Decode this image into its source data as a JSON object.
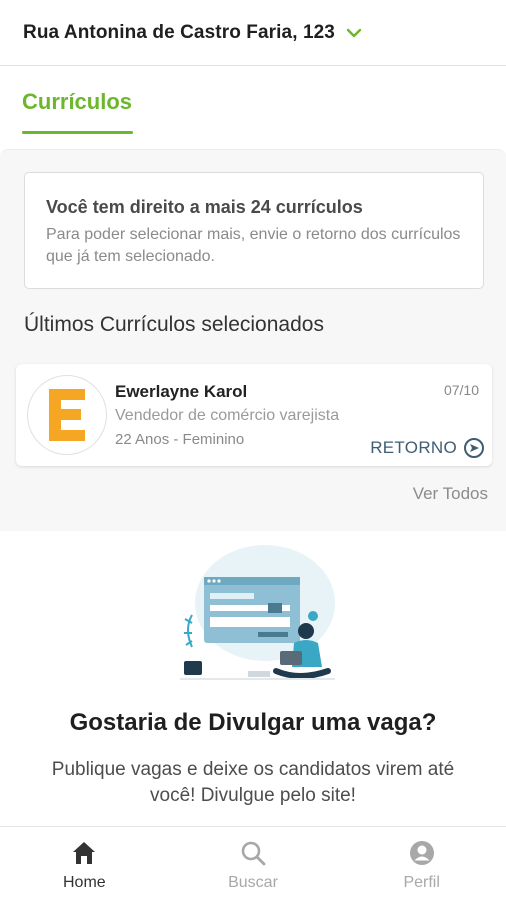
{
  "header": {
    "address": "Rua Antonina de Castro Faria, 123",
    "dropdown_icon": "chevron-down-icon"
  },
  "tabs": {
    "active_label": "Currículos"
  },
  "notice": {
    "title": "Você tem direito a mais 24 currículos",
    "text": "Para poder selecionar mais, envie o retorno dos currículos que já tem selecionado."
  },
  "section": {
    "title": "Últimos Currículos selecionados"
  },
  "candidates": [
    {
      "initial": "E",
      "name": "Ewerlayne Karol",
      "role": "Vendedor de comércio varejista",
      "meta": "22 Anos - Feminino",
      "date": "07/10",
      "action_label": "RETORNO"
    }
  ],
  "view_all_label": "Ver Todos",
  "promo": {
    "title": "Gostaria de Divulgar uma vaga?",
    "text": "Publique vagas e deixe os candidatos virem até você! Divulgue pelo site!"
  },
  "bottom_nav": [
    {
      "label": "Home",
      "icon": "home-icon",
      "active": true
    },
    {
      "label": "Buscar",
      "icon": "search-icon",
      "active": false
    },
    {
      "label": "Perfil",
      "icon": "profile-icon",
      "active": false
    }
  ],
  "colors": {
    "accent": "#6cb72c",
    "avatar_letter": "#f5a623",
    "action": "#3f5d72"
  }
}
